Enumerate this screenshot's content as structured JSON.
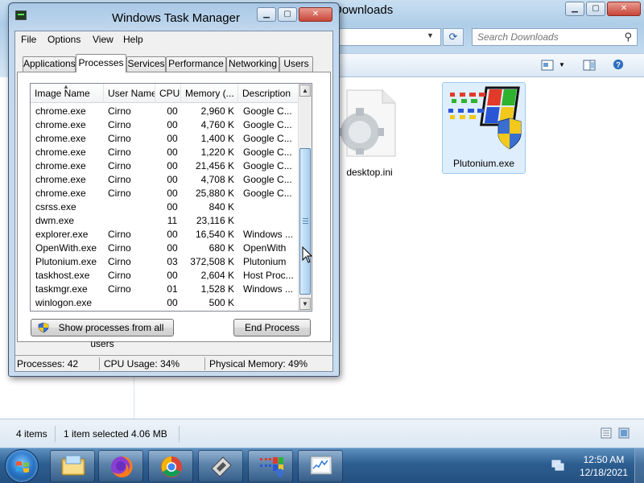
{
  "explorer": {
    "title_fragment": "Downloads",
    "search_placeholder": "Search Downloads",
    "files": [
      {
        "name": "desktop.ini",
        "icon": "gear-settings-file-icon"
      },
      {
        "name": "Plutonium.exe",
        "icon": "plutonium-app-icon"
      }
    ],
    "status": {
      "items_count": "4 items",
      "selection": "1 item selected 4.06 MB"
    }
  },
  "taskmgr": {
    "title": "Windows Task Manager",
    "menu": [
      "File",
      "Options",
      "View",
      "Help"
    ],
    "tabs": [
      "Applications",
      "Processes",
      "Services",
      "Performance",
      "Networking",
      "Users"
    ],
    "active_tab": "Processes",
    "columns": [
      "Image Name",
      "User Name",
      "CPU",
      "Memory (...",
      "Description"
    ],
    "processes": [
      {
        "name": "chrome.exe",
        "user": "Cirno",
        "cpu": "00",
        "mem": "2,960 K",
        "desc": "Google C..."
      },
      {
        "name": "chrome.exe",
        "user": "Cirno",
        "cpu": "00",
        "mem": "4,760 K",
        "desc": "Google C..."
      },
      {
        "name": "chrome.exe",
        "user": "Cirno",
        "cpu": "00",
        "mem": "1,400 K",
        "desc": "Google C..."
      },
      {
        "name": "chrome.exe",
        "user": "Cirno",
        "cpu": "00",
        "mem": "1,220 K",
        "desc": "Google C..."
      },
      {
        "name": "chrome.exe",
        "user": "Cirno",
        "cpu": "00",
        "mem": "21,456 K",
        "desc": "Google C..."
      },
      {
        "name": "chrome.exe",
        "user": "Cirno",
        "cpu": "00",
        "mem": "4,708 K",
        "desc": "Google C..."
      },
      {
        "name": "chrome.exe",
        "user": "Cirno",
        "cpu": "00",
        "mem": "25,880 K",
        "desc": "Google C..."
      },
      {
        "name": "csrss.exe",
        "user": "",
        "cpu": "00",
        "mem": "840 K",
        "desc": ""
      },
      {
        "name": "dwm.exe",
        "user": "",
        "cpu": "11",
        "mem": "23,116 K",
        "desc": ""
      },
      {
        "name": "explorer.exe",
        "user": "Cirno",
        "cpu": "00",
        "mem": "16,540 K",
        "desc": "Windows ..."
      },
      {
        "name": "OpenWith.exe",
        "user": "Cirno",
        "cpu": "00",
        "mem": "680 K",
        "desc": "OpenWith"
      },
      {
        "name": "Plutonium.exe",
        "user": "Cirno",
        "cpu": "03",
        "mem": "372,508 K",
        "desc": "Plutonium"
      },
      {
        "name": "taskhost.exe",
        "user": "Cirno",
        "cpu": "00",
        "mem": "2,604 K",
        "desc": "Host Proc..."
      },
      {
        "name": "taskmgr.exe",
        "user": "Cirno",
        "cpu": "01",
        "mem": "1,528 K",
        "desc": "Windows ..."
      },
      {
        "name": "winlogon.exe",
        "user": "",
        "cpu": "00",
        "mem": "500 K",
        "desc": ""
      }
    ],
    "show_all_button": "Show processes from all users",
    "end_process_button": "End Process",
    "status": {
      "processes": "Processes: 42",
      "cpu": "CPU Usage: 34%",
      "memory": "Physical Memory: 49%"
    }
  },
  "taskbar": {
    "pinned": [
      "windows-explorer-icon",
      "firefox-icon",
      "chrome-icon",
      "app-icon",
      "plutonium-icon",
      "task-manager-icon"
    ],
    "time": "12:50 AM",
    "date": "12/18/2021"
  }
}
